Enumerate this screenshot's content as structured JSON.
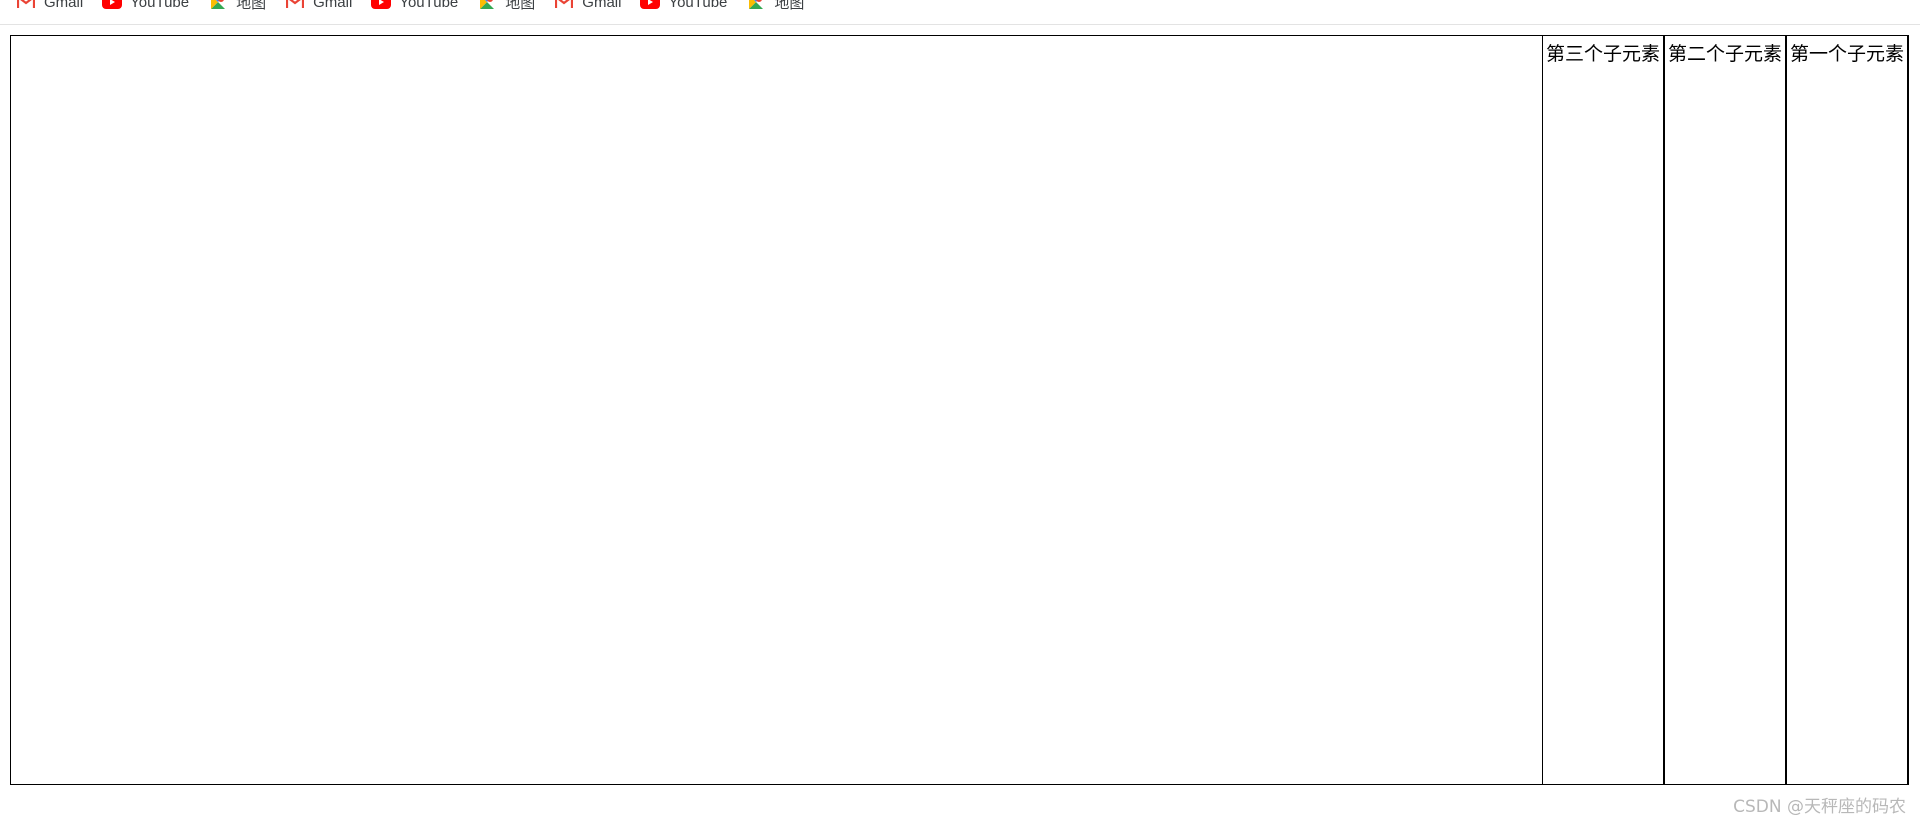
{
  "bookmarks": [
    {
      "label": "Gmail",
      "icon": "gmail-icon"
    },
    {
      "label": "YouTube",
      "icon": "youtube-icon"
    },
    {
      "label": "地图",
      "icon": "maps-icon"
    },
    {
      "label": "Gmail",
      "icon": "gmail-icon"
    },
    {
      "label": "YouTube",
      "icon": "youtube-icon"
    },
    {
      "label": "地图",
      "icon": "maps-icon"
    },
    {
      "label": "Gmail",
      "icon": "gmail-icon"
    },
    {
      "label": "YouTube",
      "icon": "youtube-icon"
    },
    {
      "label": "地图",
      "icon": "maps-icon"
    }
  ],
  "container": {
    "children": [
      {
        "label": "第一个子元素"
      },
      {
        "label": "第二个子元素"
      },
      {
        "label": "第三个子元素"
      }
    ]
  },
  "watermark": "CSDN @天秤座的码农",
  "colors": {
    "gmail_red": "#ea4335",
    "youtube_red": "#ff0000",
    "border": "#000000",
    "watermark": "#b8b8b8"
  }
}
